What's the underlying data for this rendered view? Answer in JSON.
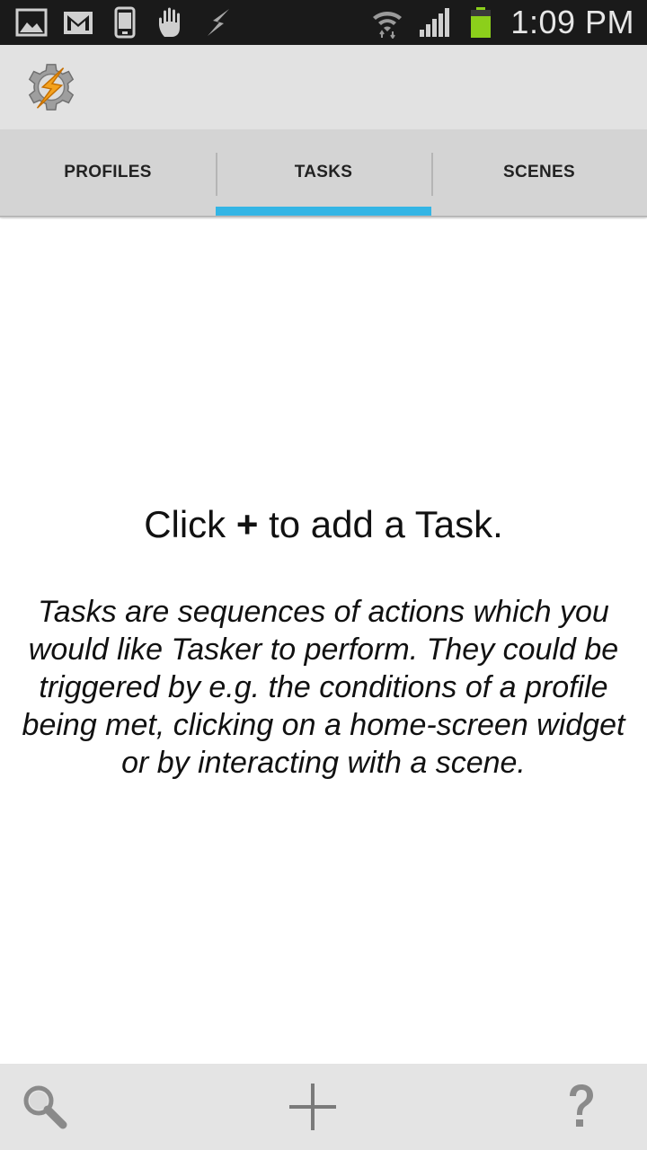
{
  "status_bar": {
    "time": "1:09 PM",
    "left_icons": [
      "image-icon",
      "gmail-icon",
      "phone-icon",
      "hand-icon",
      "flash-icon"
    ],
    "right_icons": [
      "wifi-icon",
      "signal-icon",
      "battery-icon"
    ],
    "battery_color": "#8ccf1b"
  },
  "header": {
    "logo": "tasker-logo-icon"
  },
  "tabs": [
    {
      "label": "PROFILES",
      "active": false
    },
    {
      "label": "TASKS",
      "active": true
    },
    {
      "label": "SCENES",
      "active": false
    }
  ],
  "accent_color": "#33b5e5",
  "main": {
    "hint_prefix": "Click",
    "hint_plus": "+",
    "hint_suffix": "to add a Task.",
    "description": "Tasks are sequences of actions which you would like Tasker to perform. They could be triggered by e.g. the conditions of a profile being met, clicking on a home-screen widget or by interacting with a scene."
  },
  "bottom_bar": {
    "buttons": [
      "search-icon",
      "add-icon",
      "help-icon"
    ]
  }
}
